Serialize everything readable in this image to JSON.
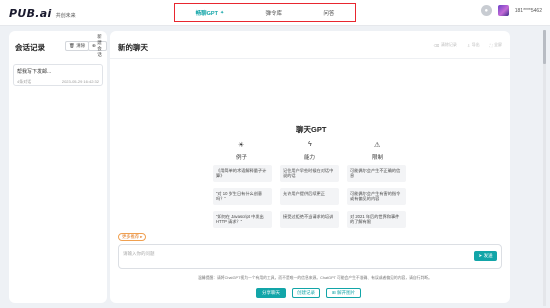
{
  "header": {
    "logo_main": "PUB.ai",
    "logo_sub": "共创未来",
    "nav": [
      "畅聊GPT",
      "弹令库",
      "问答"
    ],
    "active_indicator": "✦",
    "user_name": "181****5462"
  },
  "sidebar": {
    "title": "会话记录",
    "clear_label": "清除",
    "new_label": "新建会话",
    "items": [
      {
        "title": "帮我写下发邮...",
        "count": "4条对话",
        "time": "2023-05-29 16:42:32"
      }
    ]
  },
  "main": {
    "title": "新的聊天",
    "tools": [
      "清除记录",
      "导出",
      "全屏"
    ],
    "hero": "聊天GPT",
    "columns": [
      {
        "icon": "sun-icon",
        "head": "例子",
        "cards": [
          "《用简单的术语解释量子计算》",
          "“对 10 岁生日有什么创意吗？”",
          "“如何在 Javascript 中发出 HTTP 请求？”"
        ]
      },
      {
        "icon": "lightning-icon",
        "head": "能力",
        "cards": [
          "记住用户早些时候在对话中说的话",
          "允许用户提供后续更正",
          "接受过拒绝不当请求的培训"
        ]
      },
      {
        "icon": "warning-icon",
        "head": "限制",
        "cards": [
          "可能偶尔会产生不正确的信息",
          "可能偶尔会产生有害的指令或有偏见的内容",
          "对 2021 年后的世界和事件的了解有限"
        ]
      }
    ],
    "suggest_label": "更多推荐",
    "input_placeholder": "请输入你的问题",
    "send_label": "发送",
    "disclaimer": "温馨提醒：请将ChatGPT视为一个有用的工具，而不是唯一的信息来源。ChatGPT 可能会产生不准确、有误或者偏见的内容，请自行判断。",
    "bottom_buttons": [
      "分享聊天",
      "创建记录",
      "解开图片"
    ]
  },
  "colors": {
    "accent": "#12a5a8",
    "nav_highlight_border": "#e8262f",
    "suggest_orange": "#e07a20"
  }
}
